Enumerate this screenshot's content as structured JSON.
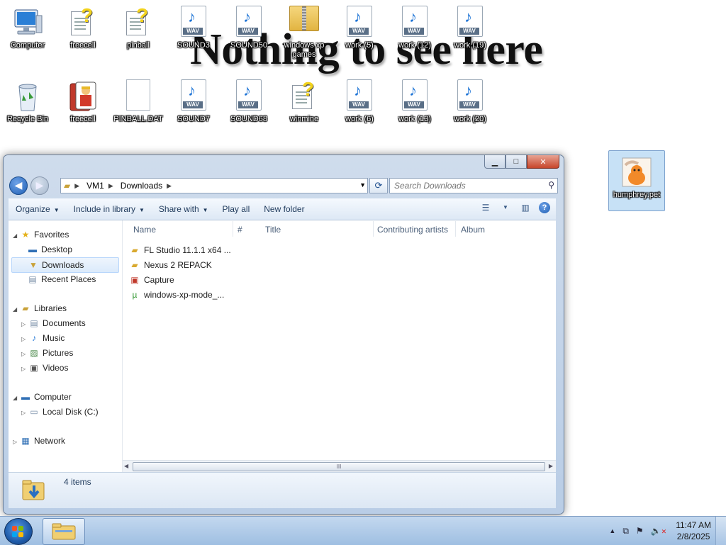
{
  "desktop": {
    "banner_text": "Nothing to see here",
    "icons_row1": [
      {
        "label": "Computer",
        "icon": "computer-icon"
      },
      {
        "label": "freecell",
        "icon": "help-document-icon"
      },
      {
        "label": "pinball",
        "icon": "help-document-icon"
      },
      {
        "label": "SOUND3",
        "icon": "wav-file-icon"
      },
      {
        "label": "SOUND50",
        "icon": "wav-file-icon"
      },
      {
        "label": "windows xp games",
        "icon": "zip-folder-icon"
      },
      {
        "label": "work (5)",
        "icon": "wav-file-icon"
      },
      {
        "label": "work (12)",
        "icon": "wav-file-icon"
      },
      {
        "label": "work (19)",
        "icon": "wav-file-icon"
      }
    ],
    "icons_row2": [
      {
        "label": "Recycle Bin",
        "icon": "recycle-bin-icon"
      },
      {
        "label": "freecell",
        "icon": "freecell-app-icon"
      },
      {
        "label": "PINBALL.DAT",
        "icon": "blank-file-icon"
      },
      {
        "label": "SOUND7",
        "icon": "wav-file-icon"
      },
      {
        "label": "SOUND68",
        "icon": "wav-file-icon"
      },
      {
        "label": "winmine",
        "icon": "help-document-icon"
      },
      {
        "label": "work (6)",
        "icon": "wav-file-icon"
      },
      {
        "label": "work (13)",
        "icon": "wav-file-icon"
      },
      {
        "label": "work (20)",
        "icon": "wav-file-icon"
      }
    ],
    "selected_icon": {
      "label": "humphrey.pet",
      "icon": "pet-file-icon"
    },
    "wav_tag": "WAV"
  },
  "explorer": {
    "breadcrumb": [
      "VM1",
      "Downloads"
    ],
    "search_placeholder": "Search Downloads",
    "toolbar": {
      "organize": "Organize",
      "include_in_library": "Include in library",
      "share_with": "Share with",
      "play_all": "Play all",
      "new_folder": "New folder"
    },
    "nav": {
      "favorites": "Favorites",
      "desktop": "Desktop",
      "downloads": "Downloads",
      "recent_places": "Recent Places",
      "libraries": "Libraries",
      "documents": "Documents",
      "music": "Music",
      "pictures": "Pictures",
      "videos": "Videos",
      "computer": "Computer",
      "local_disk": "Local Disk (C:)",
      "network": "Network"
    },
    "columns": {
      "name": "Name",
      "number": "#",
      "title": "Title",
      "contributing_artists": "Contributing artists",
      "album": "Album"
    },
    "files": [
      {
        "name": "FL Studio 11.1.1 x64 ...",
        "icon": "folder-icon"
      },
      {
        "name": "Nexus 2 REPACK",
        "icon": "folder-icon"
      },
      {
        "name": "Capture",
        "icon": "image-file-icon"
      },
      {
        "name": "windows-xp-mode_...",
        "icon": "utorrent-file-icon"
      }
    ],
    "status_count": "4 items",
    "scroll_grip": "III"
  },
  "taskbar": {
    "time": "11:47 AM",
    "date": "2/8/2025"
  }
}
